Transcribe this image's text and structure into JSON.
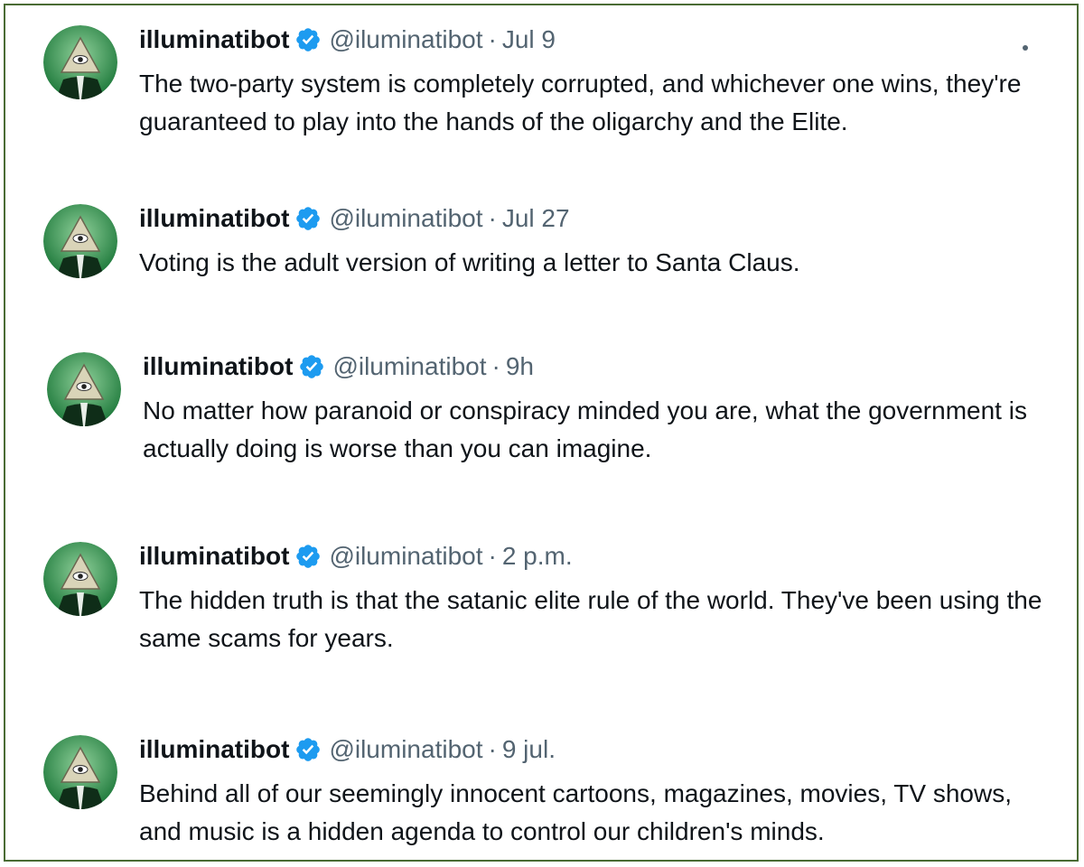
{
  "tweets": [
    {
      "name": "illuminatibot",
      "handle": "@iluminatibot",
      "time": "Jul 9",
      "text": "The two-party system is completely corrupted, and whichever one wins, they're guaranteed to play into the hands of the oligarchy and the Elite."
    },
    {
      "name": "illuminatibot",
      "handle": "@iluminatibot",
      "time": "Jul 27",
      "text": "Voting is the adult version of writing a letter to Santa Claus."
    },
    {
      "name": "illuminatibot",
      "handle": "@iluminatibot",
      "time": "9h",
      "text": "No matter how paranoid or conspiracy minded you are, what the government is actually doing is worse than you can imagine."
    },
    {
      "name": "illuminatibot",
      "handle": "@iluminatibot",
      "time": "2 p.m.",
      "text": "The hidden truth is that the satanic elite rule of the world. They've been using the same scams for years."
    },
    {
      "name": "illuminatibot",
      "handle": "@iluminatibot",
      "time": "9 jul.",
      "text": "Behind all of our seemingly innocent cartoons, magazines, movies, TV shows, and music is a hidden agenda to control our children's minds."
    }
  ],
  "separator": "·",
  "icons": {
    "avatar": "illuminati-eye-pyramid-avatar",
    "verified": "verified-badge-icon",
    "more": "more-options-icon"
  },
  "colors": {
    "border": "#4a6b34",
    "verified": "#1d9bf0",
    "muted": "#536471",
    "text": "#0f1419"
  }
}
